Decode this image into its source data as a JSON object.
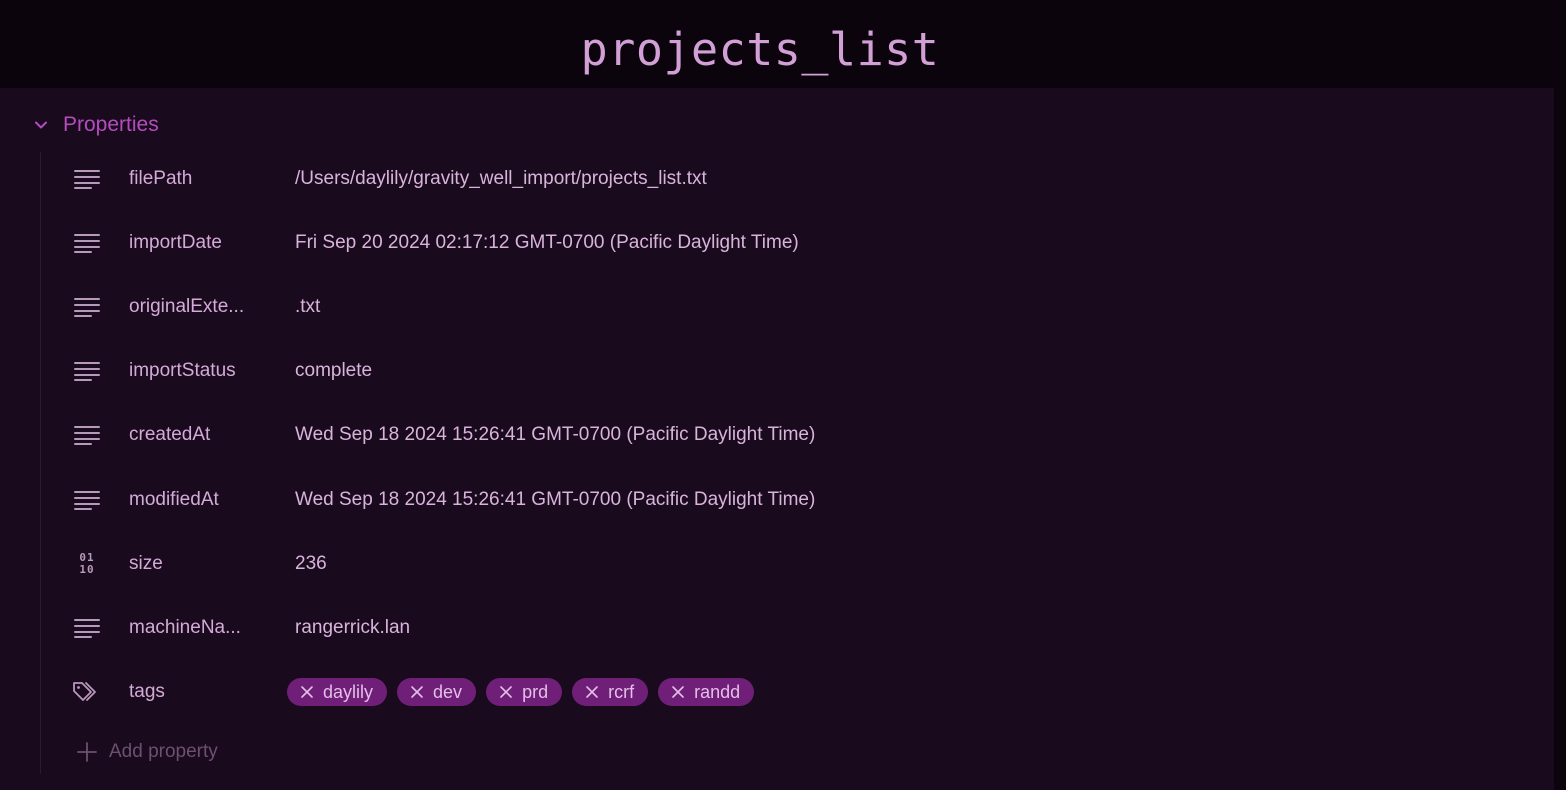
{
  "note": {
    "title": "projects_list"
  },
  "properties": {
    "header_label": "Properties",
    "rows": [
      {
        "icon": "text-lines-icon",
        "key": "filePath",
        "value": "/Users/daylily/gravity_well_import/projects_list.txt"
      },
      {
        "icon": "text-lines-icon",
        "key": "importDate",
        "value": "Fri Sep 20 2024 02:17:12 GMT-0700 (Pacific Daylight Time)"
      },
      {
        "icon": "text-lines-icon",
        "key": "originalExte...",
        "value": ".txt"
      },
      {
        "icon": "text-lines-icon",
        "key": "importStatus",
        "value": "complete"
      },
      {
        "icon": "text-lines-icon",
        "key": "createdAt",
        "value": "Wed Sep 18 2024 15:26:41 GMT-0700 (Pacific Daylight Time)"
      },
      {
        "icon": "text-lines-icon",
        "key": "modifiedAt",
        "value": "Wed Sep 18 2024 15:26:41 GMT-0700 (Pacific Daylight Time)"
      },
      {
        "icon": "number-icon",
        "key": "size",
        "value": "236",
        "icon_glyph_top": "01",
        "icon_glyph_bottom": "10"
      },
      {
        "icon": "text-lines-icon",
        "key": "machineNa...",
        "value": "rangerrick.lan"
      }
    ],
    "tags_row": {
      "icon": "tags-icon",
      "key": "tags",
      "tags": [
        "daylily",
        "dev",
        "prd",
        "rcrf",
        "randd"
      ]
    },
    "add_property_label": "Add property"
  },
  "colors": {
    "background": "#1a0a1d",
    "title_bar": "#0b040c",
    "accent": "#b44cbe",
    "tag_background": "#6f1f78",
    "text": "#d8b4dc",
    "muted": "#6d4f72"
  }
}
